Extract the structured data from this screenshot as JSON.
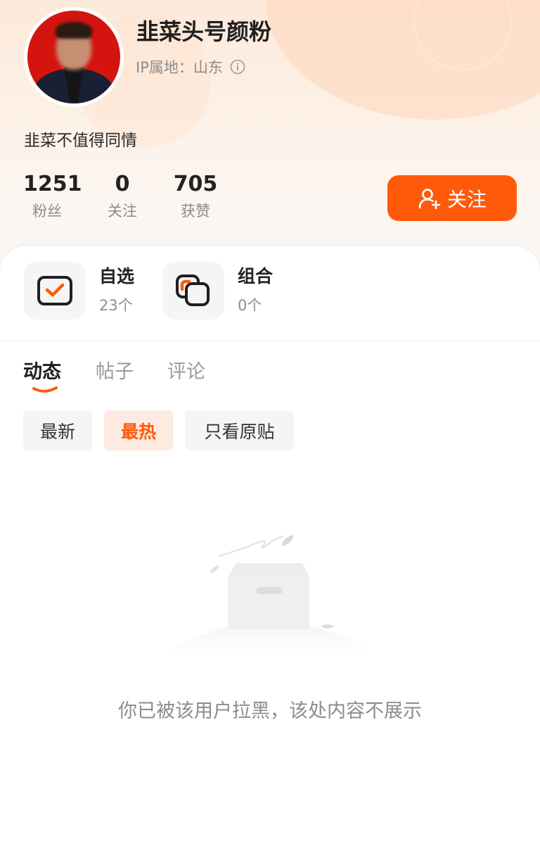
{
  "profile": {
    "username": "韭菜头号颜粉",
    "ip_location": "IP属地：山东",
    "bio": "韭菜不值得同情"
  },
  "stats": {
    "fans_value": "1251",
    "fans_label": "粉丝",
    "following_value": "0",
    "following_label": "关注",
    "likes_value": "705",
    "likes_label": "获赞"
  },
  "follow_button": {
    "label": "关注"
  },
  "shortcuts": [
    {
      "title": "自选",
      "count": "23个",
      "icon": "watchlist-check-icon"
    },
    {
      "title": "组合",
      "count": "0个",
      "icon": "portfolio-overlap-icon"
    }
  ],
  "tabs": [
    {
      "label": "动态",
      "active": true
    },
    {
      "label": "帖子",
      "active": false
    },
    {
      "label": "评论",
      "active": false
    }
  ],
  "filters": [
    {
      "label": "最新",
      "active": false
    },
    {
      "label": "最热",
      "active": true
    },
    {
      "label": "只看原贴",
      "active": false
    }
  ],
  "empty_state": {
    "message": "你已被该用户拉黑，该处内容不展示",
    "icon": "empty-box-icon"
  },
  "colors": {
    "accent": "#ff5a0a",
    "accent_light": "#fdebe1",
    "header_gradient_top": "#fde9da"
  }
}
